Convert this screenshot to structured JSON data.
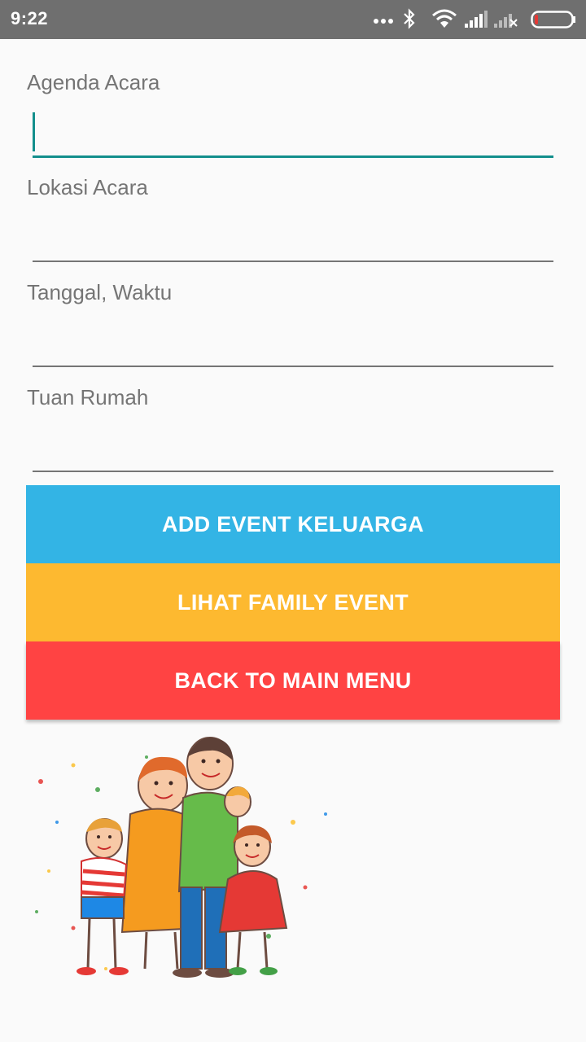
{
  "status_bar": {
    "time": "9:22",
    "icons": [
      "more-dots-icon",
      "bluetooth-icon",
      "wifi-icon",
      "signal-icon",
      "signal-no-service-icon",
      "battery-icon"
    ]
  },
  "form": {
    "fields": [
      {
        "label": "Agenda Acara",
        "value": ""
      },
      {
        "label": "Lokasi Acara",
        "value": ""
      },
      {
        "label": "Tanggal, Waktu",
        "value": ""
      },
      {
        "label": "Tuan Rumah",
        "value": ""
      }
    ]
  },
  "buttons": {
    "add_event": "ADD EVENT KELUARGA",
    "view_events": "LIHAT FAMILY EVENT",
    "back_main": "BACK TO MAIN MENU"
  },
  "colors": {
    "accent": "#138f8c",
    "add_button": "#33b4e5",
    "view_button": "#fdb930",
    "back_button": "#ff4343"
  },
  "illustration": {
    "name": "family-illustration"
  }
}
